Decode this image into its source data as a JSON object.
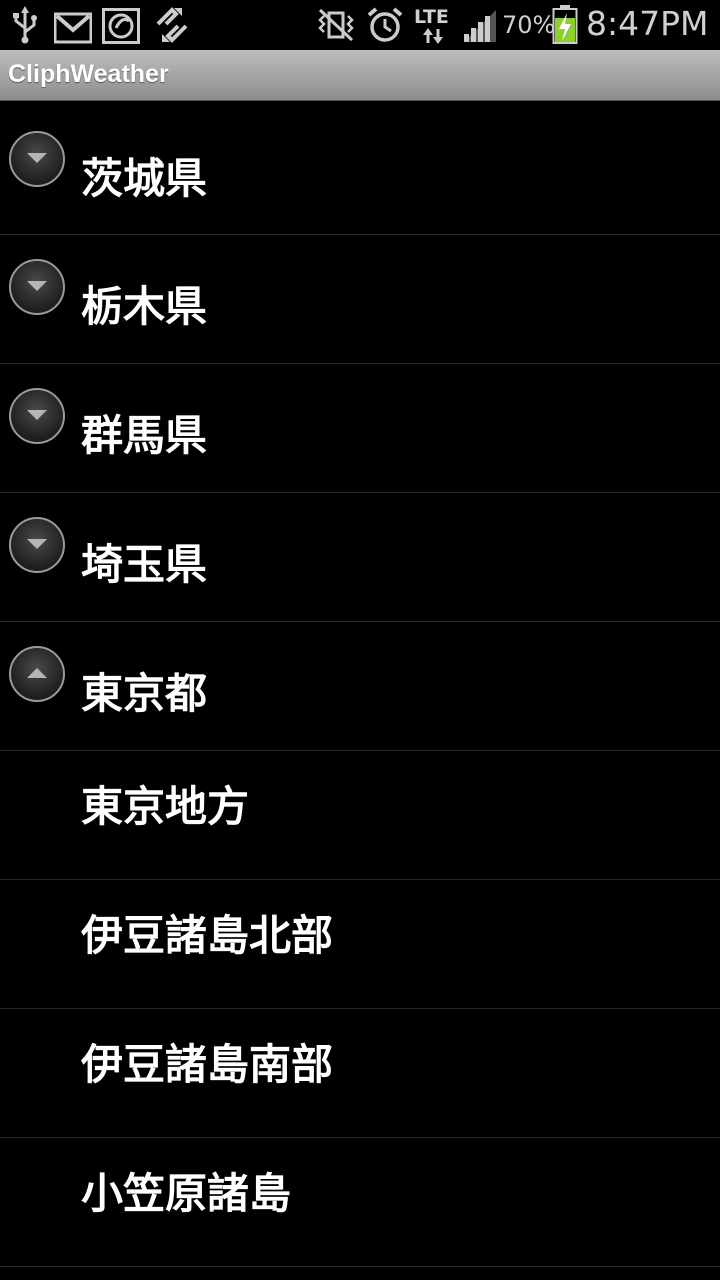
{
  "status_bar": {
    "battery_percent": "70%",
    "network_type": "LTE",
    "time": "8:47PM",
    "icons": [
      "usb-icon",
      "gmail-icon",
      "app-icon",
      "sync-icon",
      "vibrate-icon",
      "alarm-icon",
      "lte-icon",
      "signal-icon",
      "battery-charging-icon"
    ]
  },
  "app": {
    "title": "CliphWeather"
  },
  "list": {
    "groups": [
      {
        "label": "茨城県",
        "expanded": false
      },
      {
        "label": "栃木県",
        "expanded": false
      },
      {
        "label": "群馬県",
        "expanded": false
      },
      {
        "label": "埼玉県",
        "expanded": false
      },
      {
        "label": "東京都",
        "expanded": true
      }
    ],
    "children": [
      {
        "label": "東京地方"
      },
      {
        "label": "伊豆諸島北部"
      },
      {
        "label": "伊豆諸島南部"
      },
      {
        "label": "小笠原諸島"
      }
    ]
  },
  "colors": {
    "background": "#000000",
    "title_bar": "#a8a8a8",
    "divider": "#2a2a2a",
    "text": "#ffffff"
  }
}
